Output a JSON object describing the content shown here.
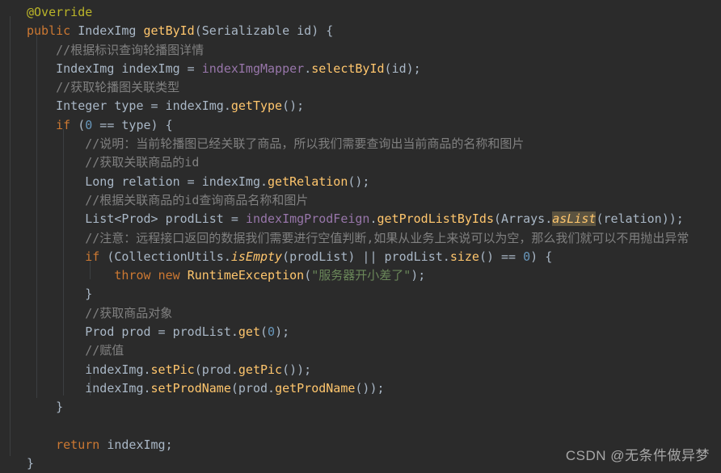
{
  "editor": {
    "background": "#2b2b2b",
    "foreground": "#a9b7c6",
    "language": "java",
    "colors": {
      "annotation": "#bbb529",
      "keyword": "#cc7832",
      "number": "#6897bb",
      "string": "#6a8759",
      "comment": "#808080",
      "field": "#9876aa",
      "method": "#ffc66d",
      "identifier": "#a9b7c6",
      "highlight": "#5b5340",
      "indent_guide": "#3c3f41"
    }
  },
  "code": {
    "lines": [
      "@Override",
      "public IndexImg getById(Serializable id) {",
      "    //根据标识查询轮播图详情",
      "    IndexImg indexImg = indexImgMapper.selectById(id);",
      "    //获取轮播图关联类型",
      "    Integer type = indexImg.getType();",
      "    if (0 == type) {",
      "        //说明：当前轮播图已经关联了商品，所以我们需要查询出当前商品的名称和图片",
      "        //获取关联商品的id",
      "        Long relation = indexImg.getRelation();",
      "        //根据关联商品的id查询商品名称和图片",
      "        List<Prod> prodList = indexImgProdFeign.getProdListByIds(Arrays.asList(relation));",
      "        //注意：远程接口返回的数据我们需要进行空值判断,如果从业务上来说可以为空，那么我们就可以不用抛出异常",
      "        if (CollectionUtils.isEmpty(prodList) || prodList.size() == 0) {",
      "            throw new RuntimeException(\"服务器开小差了\");",
      "        }",
      "        //获取商品对象",
      "        Prod prod = prodList.get(0);",
      "        //赋值",
      "        indexImg.setPic(prod.getPic());",
      "        indexImg.setProdName(prod.getProdName());",
      "    }",
      "",
      "    return indexImg;",
      "}"
    ],
    "highlighted_token": "asList"
  },
  "watermark": {
    "text": "CSDN @无条件做异梦"
  }
}
